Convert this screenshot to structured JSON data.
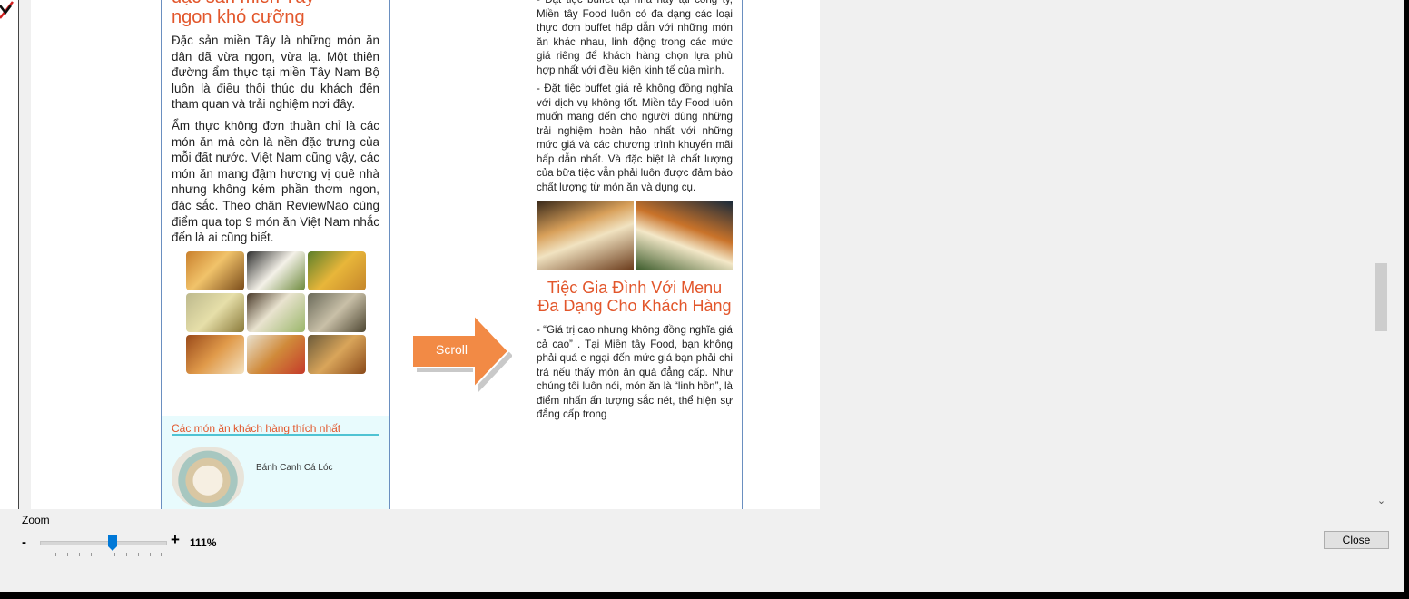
{
  "page1": {
    "title_line1": "đặc sản miền Tây",
    "title_line2": "ngon khó cưỡng",
    "para1": "Đặc sản miền Tây là những món ăn dân dã vừa ngon, vừa lạ. Một thiên đường ẩm thực tại miền Tây Nam Bộ luôn là điều thôi thúc du khách đến tham quan và trải nghiệm nơi đây.",
    "para2": "Ẩm thực không đơn thuần chỉ là các món ăn mà còn là nền đặc trưng của mỗi đất nước. Việt Nam cũng vậy, các món ăn mang đậm hương vị quê nhà nhưng không kém phần thơm ngon, đặc sắc. Theo chân ReviewNao cùng điểm qua top 9 món ăn Việt Nam nhắc đến là ai cũng biết.",
    "section_title": "Các món ăn khách hàng thích nhất",
    "dish_name": "Bánh Canh Cá Lóc"
  },
  "page2": {
    "para1": "- Đặt tiệc buffet tại nhà hay tại công ty, Miền tây Food luôn có đa dạng các loại thực đơn buffet hấp dẫn với những món ăn khác nhau, linh động trong các mức giá riêng để khách hàng chọn lựa phù hợp nhất với điều kiện kinh tế của mình.",
    "para2": "- Đặt tiệc buffet giá rẻ không đồng nghĩa với dịch vụ không tốt. Miền tây Food luôn muốn mang đến cho người dùng những trải nghiệm hoàn hảo nhất với những mức giá và các chương trình khuyến mãi hấp dẫn nhất. Và đặc biệt là chất lượng của bữa tiệc vẫn phải luôn được đảm bảo chất lượng từ món ăn và dụng cụ.",
    "heading": "Tiệc Gia Đình Với Menu Đa Dạng Cho Khách Hàng",
    "para3": "- “Giá trị cao nhưng không đồng nghĩa giá cả cao” . Tại Miền tây Food, bạn không phải quá e ngại đến mức giá bạn phải chi trả nếu thấy món ăn quá đẳng cấp. Như chúng tôi luôn nói, món ăn là “linh hồn”, là điểm nhấn ấn tượng sắc nét, thể hiện sự đẳng cấp trong"
  },
  "arrow_label": "Scroll",
  "zoom": {
    "label": "Zoom",
    "minus": "-",
    "plus": "+",
    "value": "111%",
    "slider_fraction": 0.58
  },
  "close_label": "Close",
  "colors": {
    "title_red": "#e2562b",
    "arrow_orange": "#f28a45",
    "section_bg": "#e8fbfd",
    "section_line": "#4fc3d3",
    "page_border": "#6a8fc0"
  },
  "icons": {
    "scroll_down": "chevron-down-icon",
    "corner": "pen-corner-icon"
  }
}
